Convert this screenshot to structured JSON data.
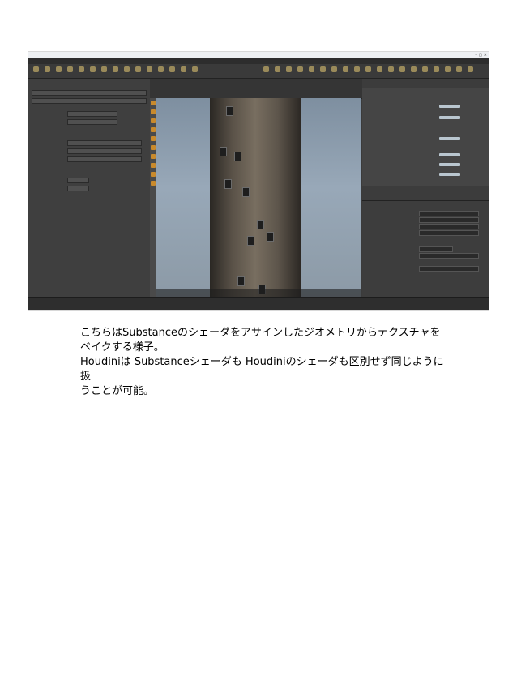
{
  "caption": "こちらはSubstanceのシェーダをアサインしたジオメトリからテクスチャを\nベイクする様子。\nHoudiniは Substanceシェーダも Houdiniのシェーダも区別せず同じように扱\nうことが可能。",
  "screenshot_alt_colors": {
    "ui_background": "#3b3b3b",
    "accent": "#c98a2c",
    "node_label": "#5fc0f0"
  }
}
